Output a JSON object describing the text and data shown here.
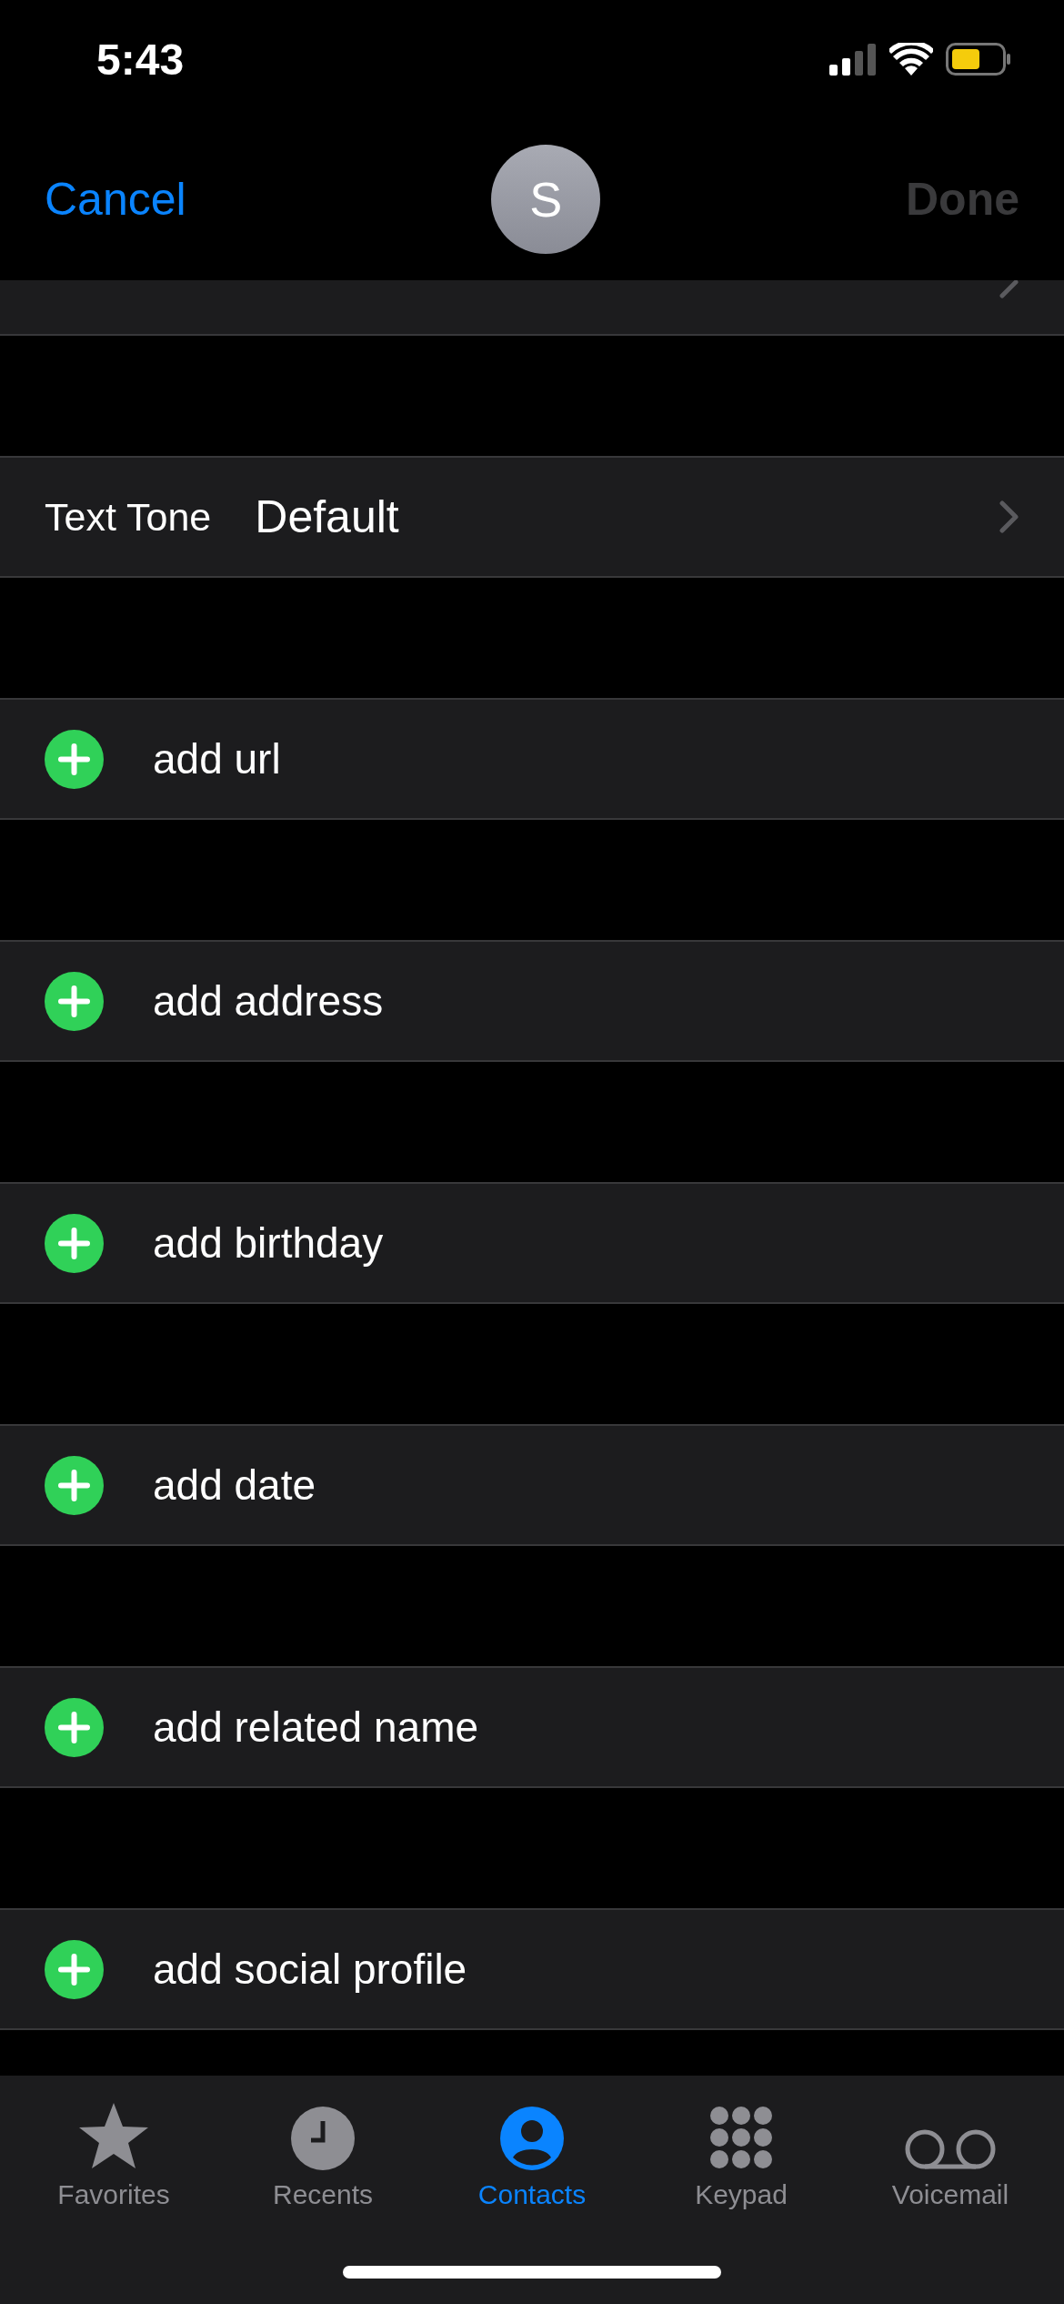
{
  "status_bar": {
    "time": "5:43"
  },
  "nav": {
    "cancel": "Cancel",
    "avatar_initial": "S",
    "done": "Done",
    "done_disabled": true
  },
  "settings_rows": [
    {
      "label": "Text Tone",
      "value": "Default"
    }
  ],
  "add_rows": [
    {
      "label": "add url"
    },
    {
      "label": "add address"
    },
    {
      "label": "add birthday"
    },
    {
      "label": "add date"
    },
    {
      "label": "add related name"
    },
    {
      "label": "add social profile"
    }
  ],
  "tabs": [
    {
      "label": "Favorites",
      "kind": "star",
      "selected": false
    },
    {
      "label": "Recents",
      "kind": "clock",
      "selected": false
    },
    {
      "label": "Contacts",
      "kind": "person",
      "selected": true
    },
    {
      "label": "Keypad",
      "kind": "keypad",
      "selected": false
    },
    {
      "label": "Voicemail",
      "kind": "voicemail",
      "selected": false
    }
  ]
}
